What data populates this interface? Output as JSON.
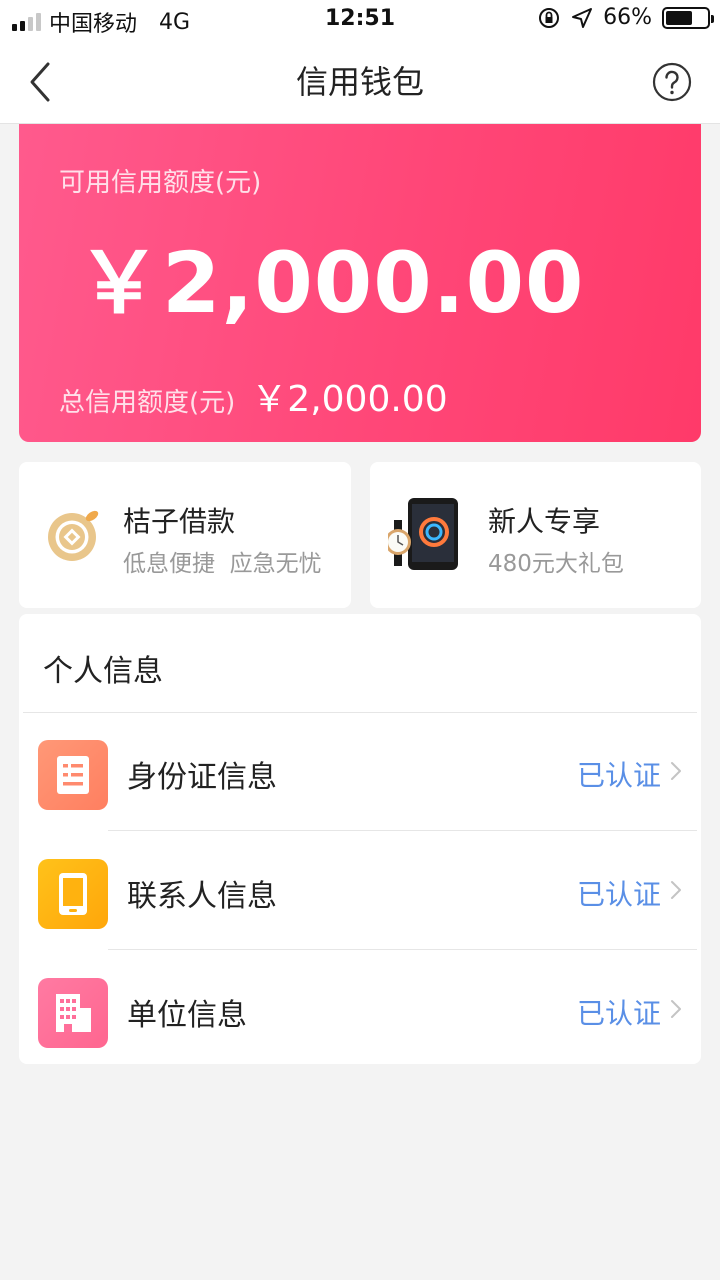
{
  "status_bar": {
    "carrier": "中国移动",
    "network": "4G",
    "time": "12:51",
    "battery_percent": "66%",
    "battery_level": 0.66,
    "signal_bars_filled": 2,
    "signal_bars_total": 4
  },
  "nav": {
    "title": "信用钱包"
  },
  "credit": {
    "available_label": "可用信用额度(元)",
    "available_amount": "￥2,000.00",
    "total_label": "总信用额度(元)",
    "total_amount": "￥2,000.00"
  },
  "promos": [
    {
      "title": "桔子借款",
      "subtitle": "低息便捷  应急无忧",
      "icon": "coin-icon"
    },
    {
      "title": "新人专享",
      "subtitle": "480元大礼包",
      "icon": "phone-watch-icon"
    }
  ],
  "personal_info": {
    "title": "个人信息",
    "items": [
      {
        "label": "身份证信息",
        "status": "已认证",
        "icon": "id-card-icon",
        "color": "#ff8a6e"
      },
      {
        "label": "联系人信息",
        "status": "已认证",
        "icon": "phone-icon",
        "color": "#ffb20f"
      },
      {
        "label": "单位信息",
        "status": "已认证",
        "icon": "building-icon",
        "color": "#ff6f9a"
      }
    ]
  },
  "colors": {
    "card_gradient_start": "#ff5a8d",
    "card_gradient_end": "#ff3a69",
    "status_verified": "#5a8fe6",
    "page_background": "#f3f3f3"
  }
}
